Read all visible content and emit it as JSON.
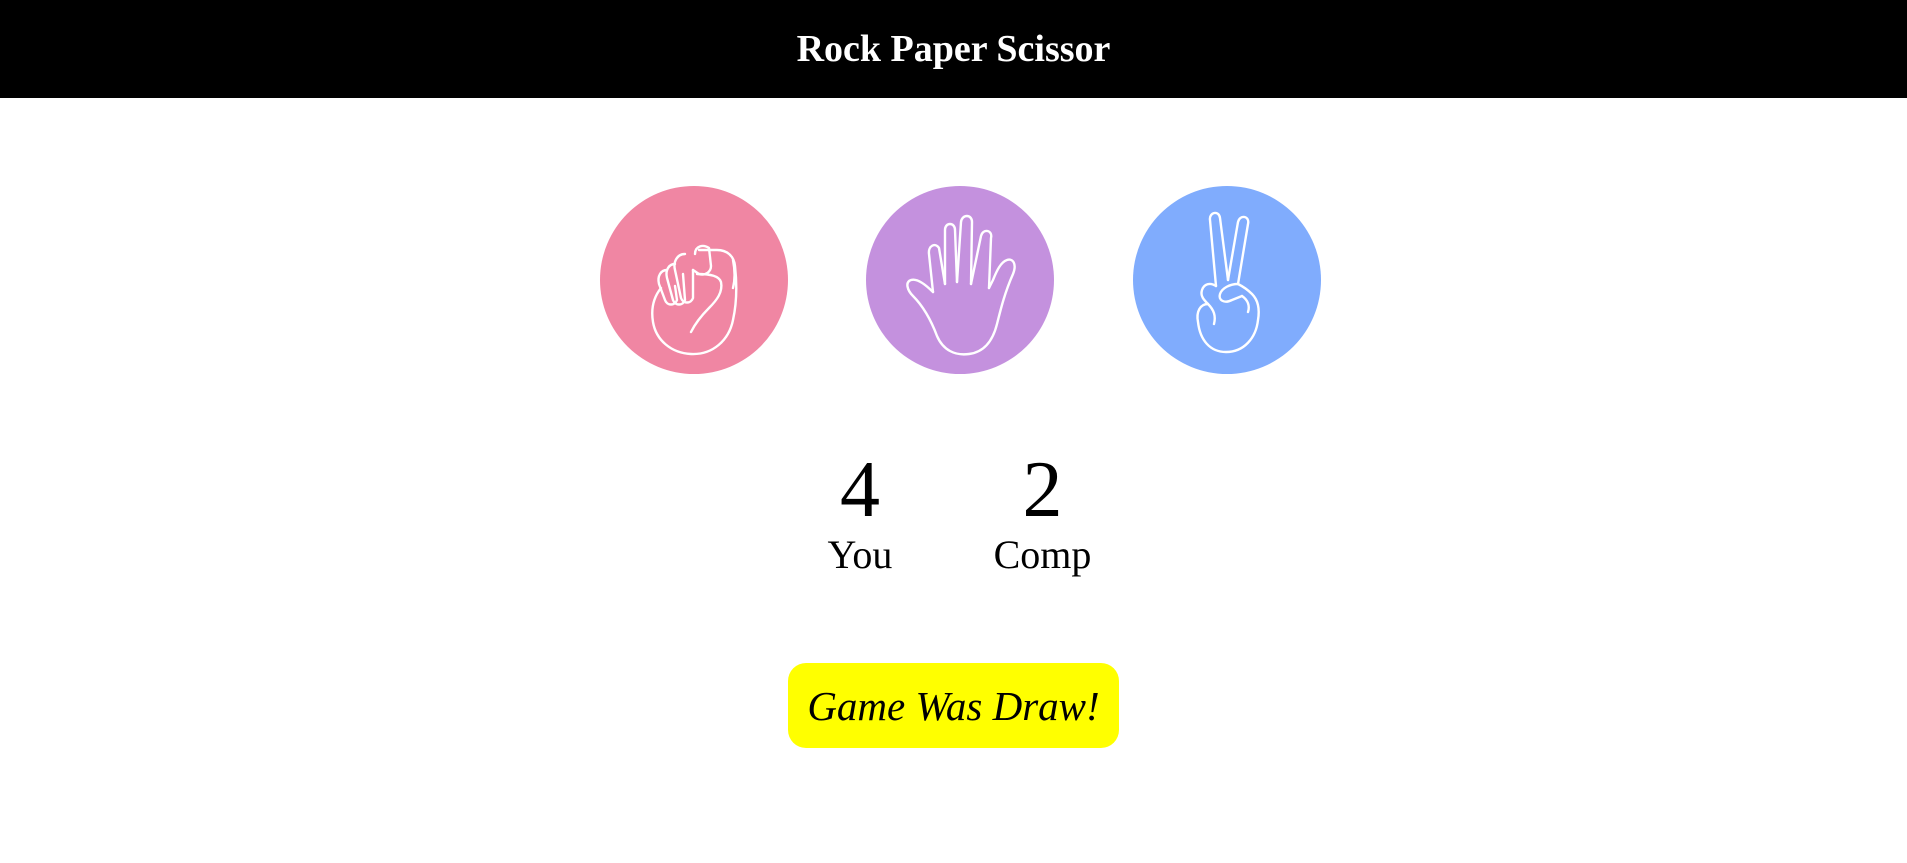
{
  "header": {
    "title": "Rock Paper Scissor"
  },
  "choices": [
    {
      "id": "rock",
      "icon": "fist-icon",
      "color": "#f086a3"
    },
    {
      "id": "paper",
      "icon": "open-hand-icon",
      "color": "#c491de"
    },
    {
      "id": "scissors",
      "icon": "peace-hand-icon",
      "color": "#80acfd"
    }
  ],
  "scoreboard": {
    "user": {
      "score": "4",
      "label": "You"
    },
    "comp": {
      "score": "2",
      "label": "Comp"
    }
  },
  "message": {
    "text": "Game Was Draw!",
    "color": "#ffff00"
  }
}
